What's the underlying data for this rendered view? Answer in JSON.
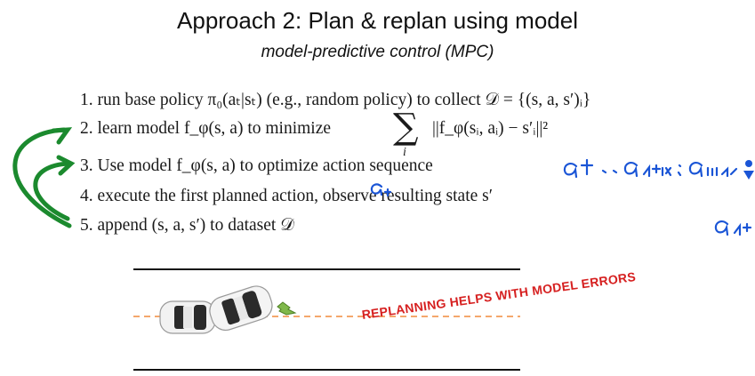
{
  "slide": {
    "title_bold": "Approach 2:",
    "title_rest": " Plan & replan using model",
    "subtitle": "model-predictive control (MPC)"
  },
  "steps": [
    {
      "num": "1.",
      "text": "run base policy π₀(aₜ|sₜ) (e.g., random policy) to collect 𝒟 = {(s, a, s′)ᵢ}"
    },
    {
      "num": "2.",
      "text": "learn model f_φ(s, a) to minimize",
      "formula": "||f_φ(sᵢ, aᵢ) − s′ᵢ||²",
      "sum_symbol": "∑",
      "sum_index": "i"
    },
    {
      "num": "3.",
      "text": "Use model f_φ(s, a) to optimize action sequence"
    },
    {
      "num": "4.",
      "text": "execute the first planned action, observe resulting state s′"
    },
    {
      "num": "5.",
      "text": "append (s, a, s′) to dataset 𝒟"
    }
  ],
  "annotations": {
    "handwriting_color": "#1a55d6",
    "arrow_color": "#1b8a2e",
    "caption": "REPLANNING HELPS WITH MODEL ERRORS",
    "caption_color": "#d62020"
  }
}
